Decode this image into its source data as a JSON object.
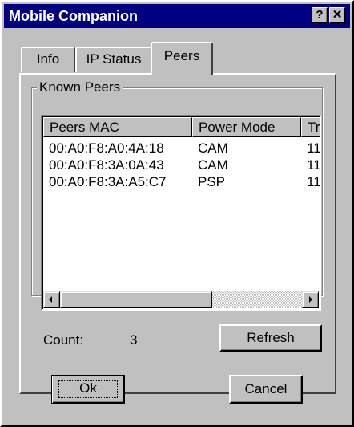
{
  "window": {
    "title": "Mobile Companion",
    "help_button": "?",
    "close_button": "✕"
  },
  "tabs": [
    {
      "label": "Info",
      "selected": false
    },
    {
      "label": "IP Status",
      "selected": false
    },
    {
      "label": "Peers",
      "selected": true
    }
  ],
  "peers": {
    "group_label": "Known Peers",
    "columns": [
      "Peers MAC",
      "Power Mode",
      "Tr"
    ],
    "rows": [
      {
        "mac": "00:A0:F8:A0:4A:18",
        "power_mode": "CAM",
        "tr": "11"
      },
      {
        "mac": "00:A0:F8:3A:0A:43",
        "power_mode": "CAM",
        "tr": "11"
      },
      {
        "mac": "00:A0:F8:3A:A5:C7",
        "power_mode": "PSP",
        "tr": "11"
      }
    ],
    "count_label": "Count:",
    "count_value": "3",
    "refresh_label": "Refresh"
  },
  "buttons": {
    "ok_label": "Ok",
    "cancel_label": "Cancel"
  },
  "colors": {
    "titlebar": "#000080",
    "face": "#c0c0c0",
    "list_background": "#ffffff"
  }
}
